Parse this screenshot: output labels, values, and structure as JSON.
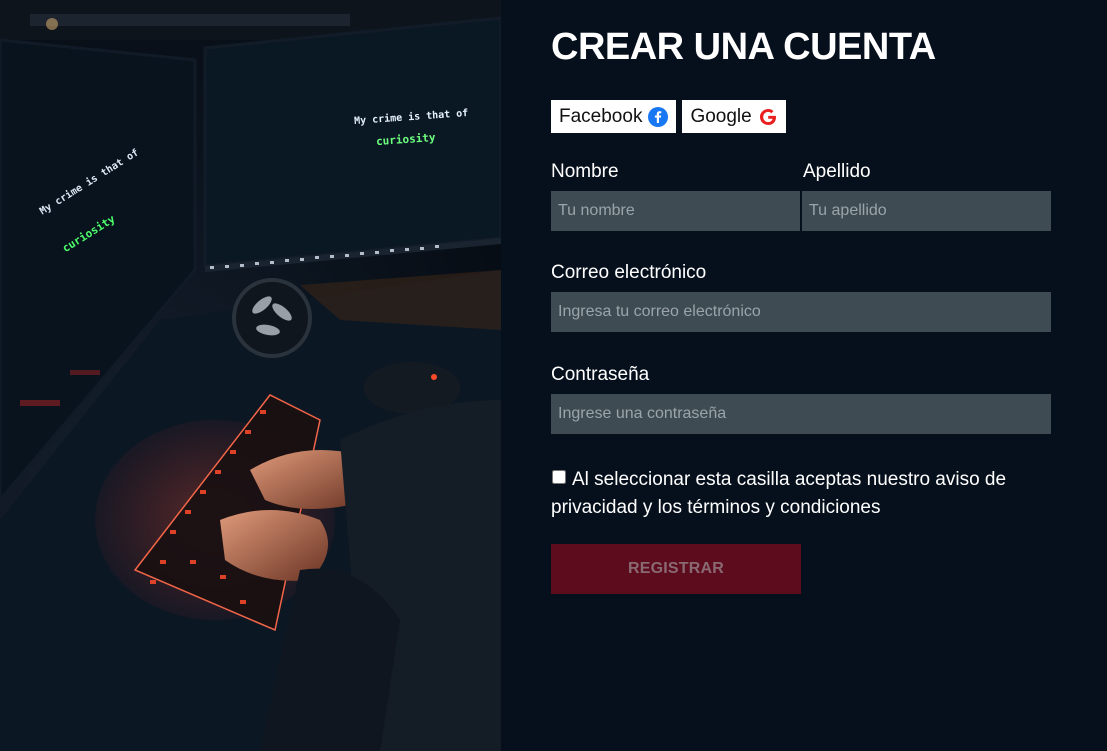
{
  "photo": {
    "monitor_line_1": "My crime is that of",
    "monitor_line_2": "curiosity",
    "monitor_line_3": "My crime is that of",
    "monitor_line_4": "curiosity"
  },
  "form": {
    "title": "CREAR UNA CUENTA",
    "social": {
      "facebook_label": "Facebook",
      "google_label": "Google"
    },
    "first_name": {
      "label": "Nombre",
      "placeholder": "Tu nombre",
      "value": ""
    },
    "last_name": {
      "label": "Apellido",
      "placeholder": "Tu apellido",
      "value": ""
    },
    "email": {
      "label": "Correo electrónico",
      "placeholder": "Ingresa tu correo electrónico",
      "value": ""
    },
    "password": {
      "label": "Contraseña",
      "placeholder": "Ingrese una contraseña",
      "value": ""
    },
    "terms": {
      "checked": false,
      "text": "Al seleccionar esta casilla aceptas nuestro aviso de privacidad y los términos y condiciones"
    },
    "submit_label": "REGISTRAR"
  },
  "colors": {
    "panel_background": "#06101c",
    "input_background": "#3f4b52",
    "register_button": "#5d0c1e",
    "facebook_blue": "#1877f2",
    "google_red": "#ea1f1f"
  },
  "icons": {
    "facebook": "facebook-icon",
    "google": "google-icon"
  }
}
